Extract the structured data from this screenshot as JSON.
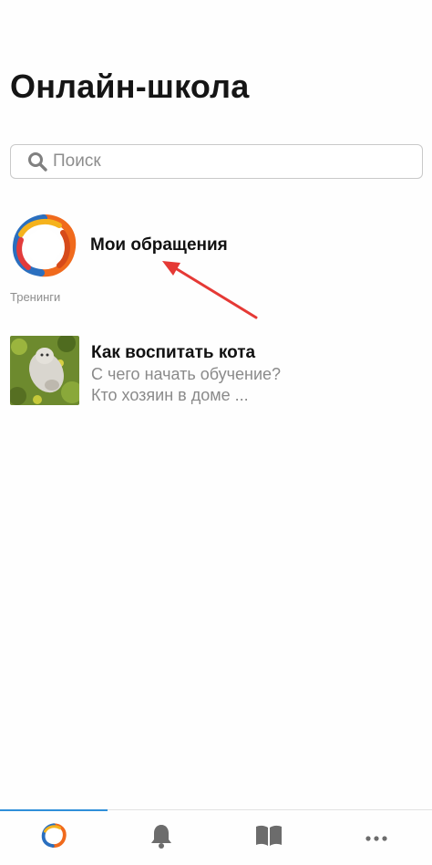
{
  "header": {
    "title": "Онлайн-школа"
  },
  "search": {
    "placeholder": "Поиск",
    "icon": "search-icon"
  },
  "appeals": {
    "label": "Мои обращения",
    "icon": "app-logo-icon"
  },
  "trainings": {
    "section_label": "Тренинги",
    "items": [
      {
        "title": "Как воспитать кота",
        "desc_line1": "С чего начать обучение?",
        "desc_line2": "Кто хозяин в доме ...",
        "thumb": "cat-photo"
      }
    ]
  },
  "tabbar": {
    "tabs": [
      {
        "icon": "app-logo-icon",
        "active": true
      },
      {
        "icon": "bell-icon",
        "active": false
      },
      {
        "icon": "book-icon",
        "active": false
      },
      {
        "icon": "more-dots-icon",
        "active": false
      }
    ]
  },
  "colors": {
    "accent": "#2f8fd9",
    "arrow": "#e53935",
    "muted": "#8a8a8a"
  }
}
